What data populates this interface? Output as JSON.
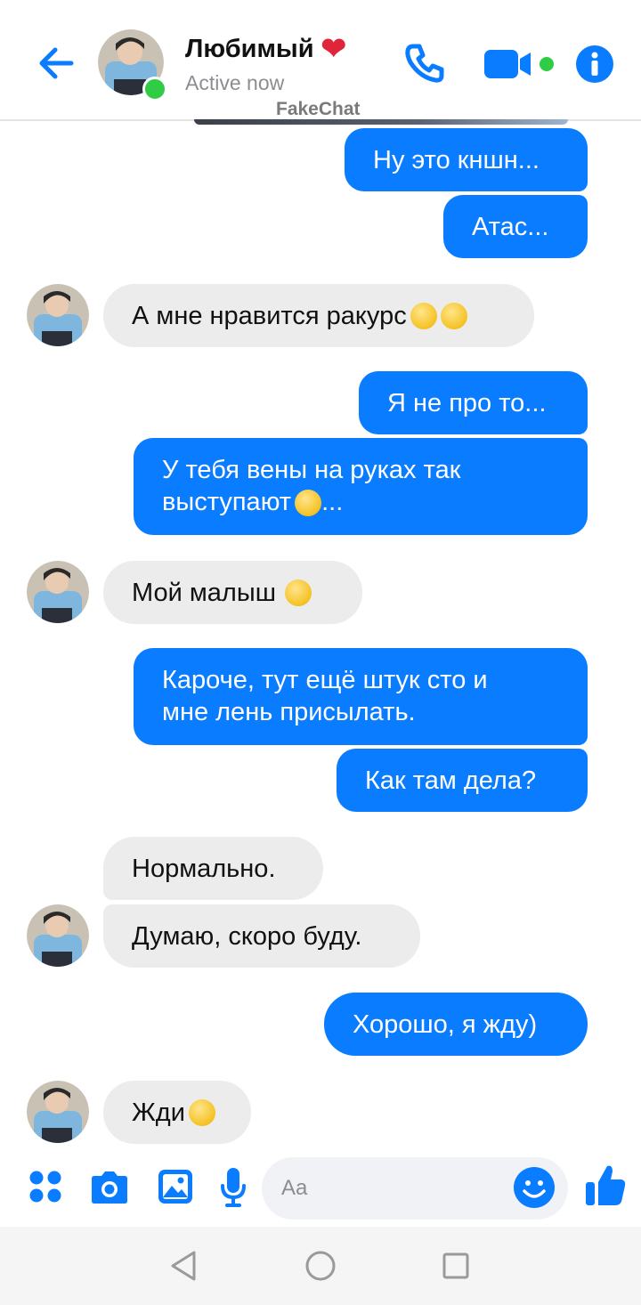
{
  "header": {
    "back_icon": "arrow-left-icon",
    "contact_name": "Любимый",
    "heart": "❤",
    "status": "Active now",
    "watermark": "FakeChat",
    "call_icon": "phone-icon",
    "video_icon": "video-camera-icon",
    "info_icon": "info-icon",
    "accent_color": "#0a7cff",
    "online_color": "#31cc46"
  },
  "messages": [
    {
      "side": "out",
      "text": "Ну это кншн..."
    },
    {
      "side": "out",
      "text": "Атас..."
    },
    {
      "side": "in",
      "text": "А мне нравится ракурс",
      "emoji": [
        "smirk",
        "grin"
      ]
    },
    {
      "side": "out",
      "text": "Я не про то..."
    },
    {
      "side": "out",
      "line1": "У тебя вены на руках так",
      "line2_a": "выступают",
      "line2_b": "...",
      "emoji": [
        "drool"
      ]
    },
    {
      "side": "in",
      "text": "Мой малыш",
      "emoji": [
        "smirk"
      ]
    },
    {
      "side": "out",
      "line1": "Кароче, тут ещё штук сто и",
      "line2": "мне лень присылать."
    },
    {
      "side": "out",
      "text": "Как там дела?"
    },
    {
      "side": "in",
      "text": "Нормально."
    },
    {
      "side": "in",
      "text": "Думаю, скоро буду."
    },
    {
      "side": "out",
      "text": "Хорошо, я жду)"
    },
    {
      "side": "in",
      "text": "Жди",
      "emoji": [
        "smirk"
      ]
    }
  ],
  "composer": {
    "placeholder": "Aa",
    "icons": [
      "apps-icon",
      "camera-icon",
      "image-icon",
      "mic-icon",
      "emoji-icon",
      "thumbs-up-icon"
    ]
  },
  "navbar": {
    "icons": [
      "back-triangle-icon",
      "home-circle-icon",
      "recents-square-icon"
    ]
  }
}
